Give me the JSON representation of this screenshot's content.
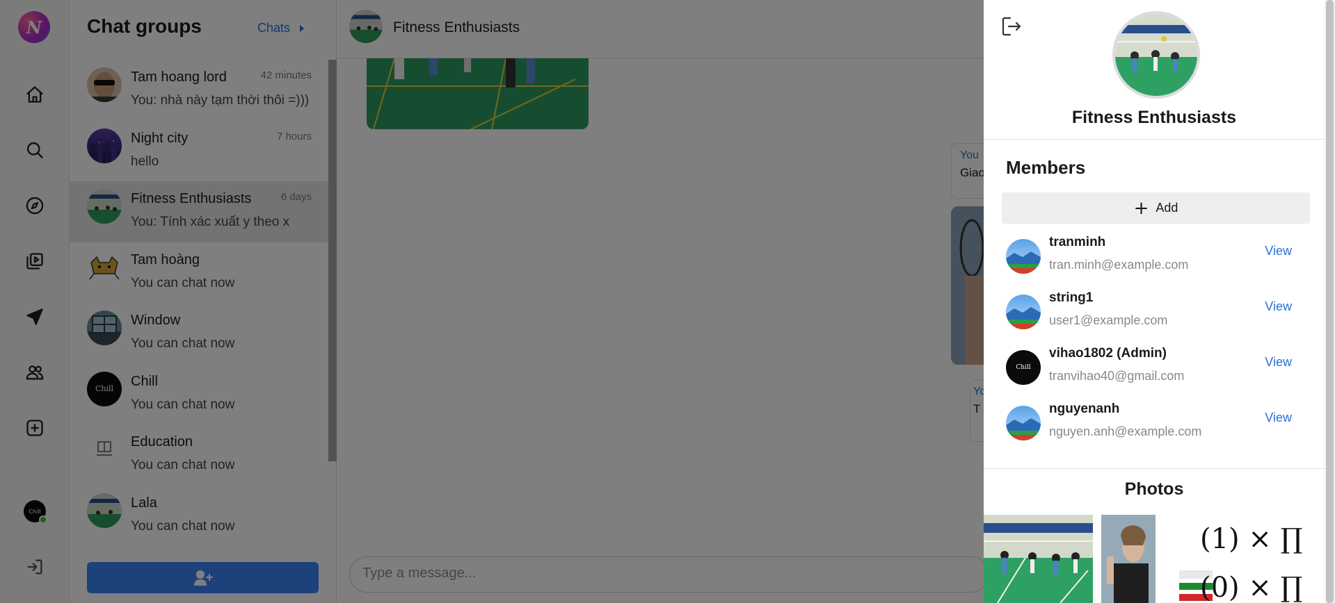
{
  "rail": {
    "logo_letter": "N",
    "items": [
      "home-icon",
      "search-icon",
      "compass-icon",
      "video-library-icon",
      "send-icon",
      "people-icon",
      "add-square-icon"
    ],
    "profile_label": "Chill",
    "logout_icon": "logout-icon"
  },
  "chatlist": {
    "title": "Chat groups",
    "link_label": "Chats",
    "items": [
      {
        "name": "Tam hoang lord",
        "time": "42 minutes",
        "message": "You: nhà này tạm thời thôi =)))"
      },
      {
        "name": "Night city",
        "time": "7 hours",
        "message": "hello"
      },
      {
        "name": "Fitness Enthusiasts",
        "time": "6 days",
        "message": "You: Tính xác xuất y theo x"
      },
      {
        "name": "Tam hoàng",
        "time": "",
        "message": "You can chat now"
      },
      {
        "name": "Window",
        "time": "",
        "message": "You can chat now"
      },
      {
        "name": "Chill",
        "time": "",
        "message": "You can chat now"
      },
      {
        "name": "Education",
        "time": "",
        "message": "You can chat now"
      },
      {
        "name": "Lala",
        "time": "",
        "message": "You can chat now"
      }
    ],
    "chill_avatar_text": "Chill",
    "add_group_icon": "add-user-icon"
  },
  "conversation": {
    "title": "Fitness Enthusiasts",
    "messages": [
      {
        "sender": "You",
        "text": "Giao"
      },
      {
        "sender": "Yo",
        "text": "T"
      }
    ],
    "input_placeholder": "Type a message..."
  },
  "drawer": {
    "group_name": "Fitness Enthusiasts",
    "members_title": "Members",
    "add_label": "Add",
    "members": [
      {
        "name": "tranminh",
        "email": "tran.minh@example.com",
        "view": "View"
      },
      {
        "name": "string1",
        "email": "user1@example.com",
        "view": "View"
      },
      {
        "name": "vihao1802 (Admin)",
        "email": "tranvihao40@gmail.com",
        "view": "View"
      },
      {
        "name": "nguyenanh",
        "email": "nguyen.anh@example.com",
        "view": "View"
      }
    ],
    "photos_title": "Photos",
    "math_line1": "(1) × ∏",
    "math_line2": "(0) × ∏"
  },
  "colors": {
    "accent": "#3b82f6",
    "link": "#2d6fd6",
    "online": "#2ec93e",
    "overlay": "rgba(0,0,0,0.5)"
  }
}
